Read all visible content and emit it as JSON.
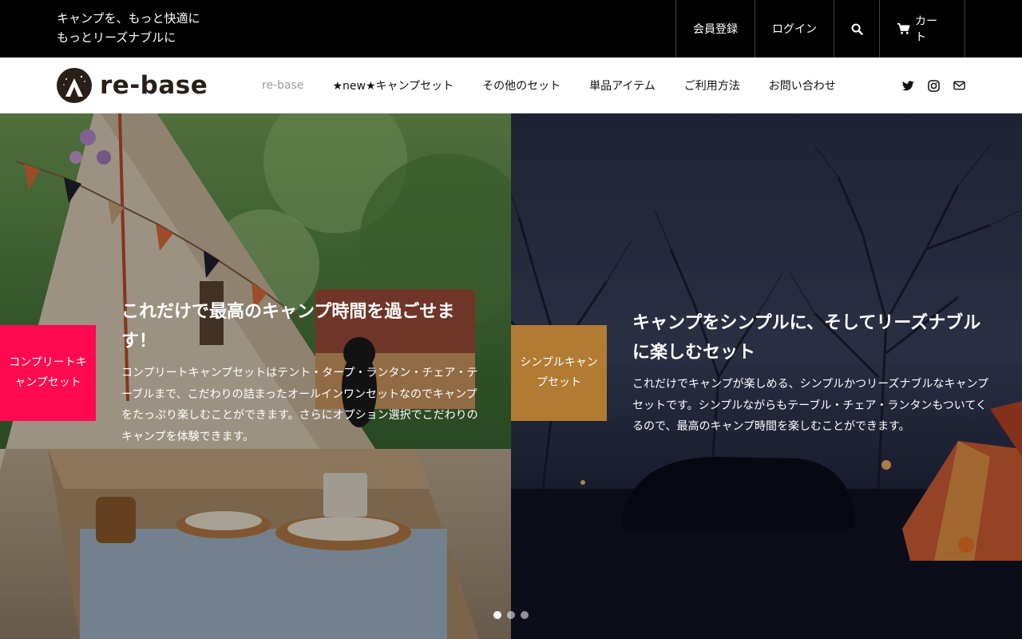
{
  "topbar": {
    "tagline_line1": "キャンプを、もっと快適に",
    "tagline_line2": "もっとリーズナブルに",
    "register_label": "会員登録",
    "login_label": "ログイン",
    "search_icon": "search-icon",
    "cart_label": "カート",
    "cart_icon": "cart-icon"
  },
  "header": {
    "logo_text": "re-base",
    "nav": [
      {
        "label": "re-base"
      },
      {
        "label": "★new★キャンプセット"
      },
      {
        "label": "その他のセット"
      },
      {
        "label": "単品アイテム"
      },
      {
        "label": "ご利用方法"
      },
      {
        "label": "お問い合わせ"
      }
    ],
    "social": [
      "twitter-icon",
      "instagram-icon",
      "mail-icon"
    ]
  },
  "hero": {
    "slides": [
      {
        "tag": "コンプリートキャンプセット",
        "title": "これだけで最高のキャンプ時間を過ごせます！",
        "body": "コンプリートキャンプセットはテント・タープ・ランタン・チェア・テーブルまで、こだわりの詰まったオールインワンセットなのでキャンプをたっぷり楽しむことができます。さらにオプション選択でこだわりのキャンプを体験できます。",
        "tag_color": "#ff0a50"
      },
      {
        "tag": "シンプルキャンプセット",
        "title": "キャンプをシンプルに、そしてリーズナブルに楽しむセット",
        "body": "これだけでキャンプが楽しめる、シンプルかつリーズナブルなキャンプセットです。シンプルながらもテーブル・チェア・ランタンもついてくるので、最高のキャンプ時間を楽しむことができます。",
        "tag_color": "#b27b33"
      }
    ],
    "pagination": {
      "count": 3,
      "active": 1
    }
  }
}
